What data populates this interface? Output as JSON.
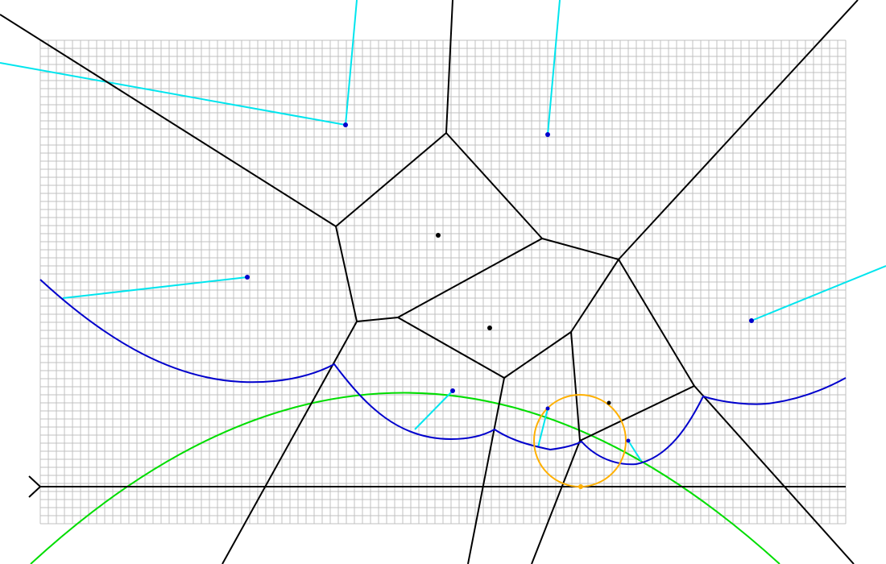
{
  "diagram": {
    "type": "voronoi-fortune-sweep",
    "grid": {
      "visible": true,
      "color": "#c0c0c0"
    },
    "colors": {
      "voronoi_edge": "#000000",
      "beach_line": "#0000cc",
      "ray": "#00e5ee",
      "site_active": "#0000cc",
      "site_processed": "#000000",
      "sweep_line": "#000000",
      "green_parabola": "#00dd00",
      "circle_event": "#ffb000",
      "circle_event_point": "#ffb000"
    }
  }
}
